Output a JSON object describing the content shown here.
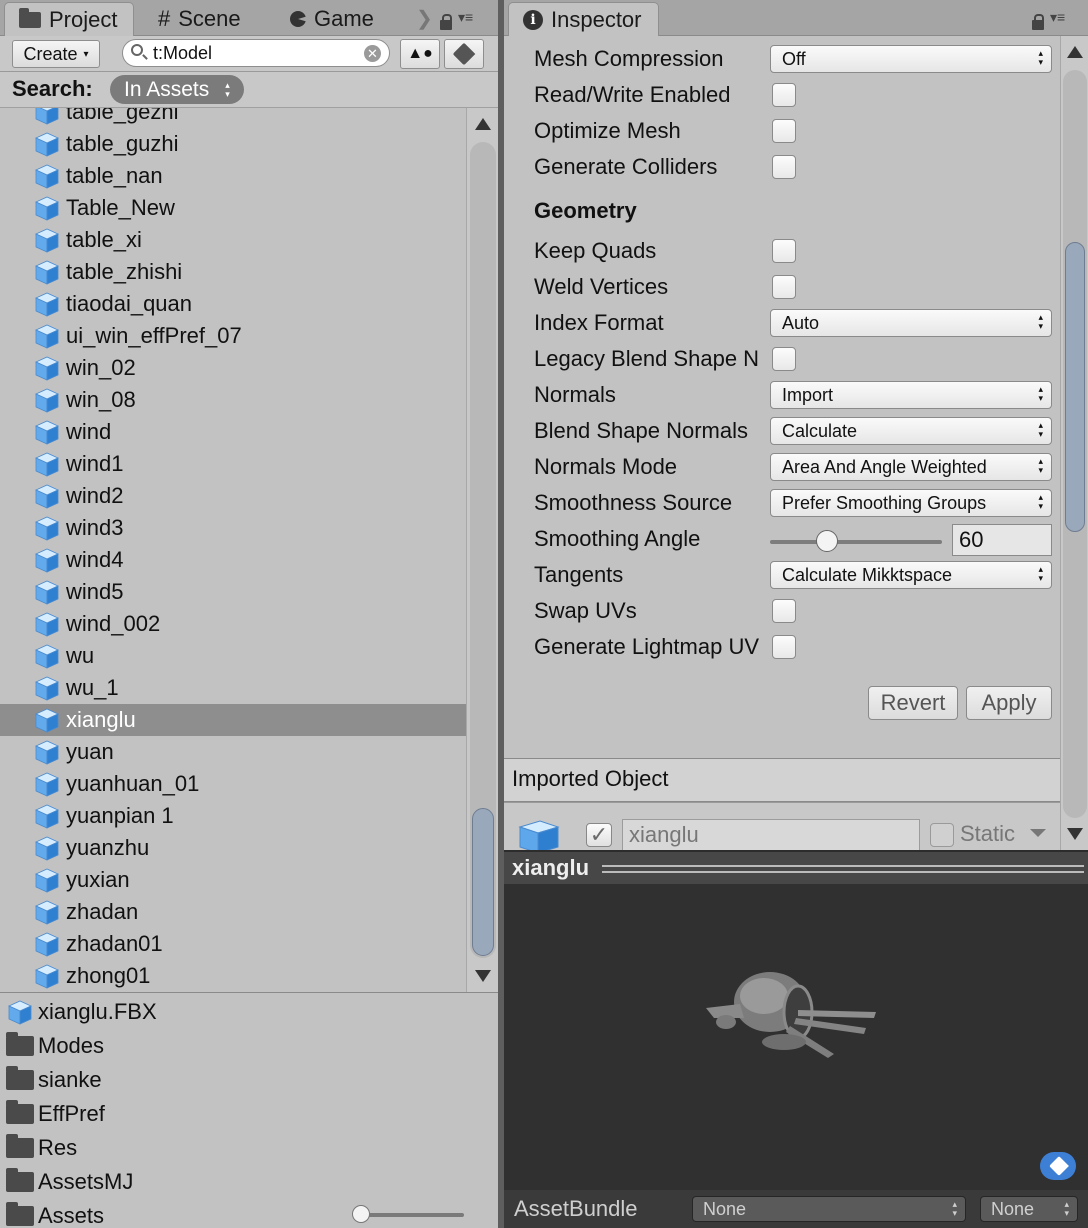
{
  "left_tabs": [
    {
      "label": "Project",
      "icon": "folder-icon"
    },
    {
      "label": "Scene",
      "icon": "grid-icon"
    },
    {
      "label": "Game",
      "icon": "pacman-icon"
    }
  ],
  "project_toolbar": {
    "create_label": "Create",
    "search_value": "t:Model"
  },
  "search_scope": {
    "label": "Search:",
    "value": "In Assets"
  },
  "assets": [
    {
      "name": "table_gezhi"
    },
    {
      "name": "table_guzhi"
    },
    {
      "name": "table_nan"
    },
    {
      "name": "Table_New"
    },
    {
      "name": "table_xi"
    },
    {
      "name": "table_zhishi"
    },
    {
      "name": "tiaodai_quan"
    },
    {
      "name": "ui_win_effPref_07"
    },
    {
      "name": "win_02"
    },
    {
      "name": "win_08"
    },
    {
      "name": "wind"
    },
    {
      "name": "wind1"
    },
    {
      "name": "wind2"
    },
    {
      "name": "wind3"
    },
    {
      "name": "wind4"
    },
    {
      "name": "wind5"
    },
    {
      "name": "wind_002"
    },
    {
      "name": "wu"
    },
    {
      "name": "wu_1"
    },
    {
      "name": "xianglu",
      "selected": true
    },
    {
      "name": "yuan"
    },
    {
      "name": "yuanhuan_01"
    },
    {
      "name": "yuanpian 1"
    },
    {
      "name": "yuanzhu"
    },
    {
      "name": "yuxian"
    },
    {
      "name": "zhadan"
    },
    {
      "name": "zhadan01"
    },
    {
      "name": "zhong01"
    }
  ],
  "folder_tree": [
    {
      "name": "xianglu.FBX",
      "icon": "model-icon"
    },
    {
      "name": "Modes",
      "icon": "folder-icon"
    },
    {
      "name": "sianke",
      "icon": "folder-icon"
    },
    {
      "name": "EffPref",
      "icon": "folder-icon"
    },
    {
      "name": "Res",
      "icon": "folder-icon"
    },
    {
      "name": "AssetsMJ",
      "icon": "folder-icon"
    },
    {
      "name": "Assets",
      "icon": "folder-icon"
    }
  ],
  "inspector": {
    "tab_label": "Inspector",
    "mesh_compression": {
      "label": "Mesh Compression",
      "value": "Off"
    },
    "read_write": {
      "label": "Read/Write Enabled",
      "checked": false
    },
    "optimize_mesh": {
      "label": "Optimize Mesh",
      "checked": false
    },
    "generate_colliders": {
      "label": "Generate Colliders",
      "checked": false
    },
    "geometry_header": "Geometry",
    "keep_quads": {
      "label": "Keep Quads",
      "checked": false
    },
    "weld_vertices": {
      "label": "Weld Vertices",
      "checked": false
    },
    "index_format": {
      "label": "Index Format",
      "value": "Auto"
    },
    "legacy_blend": {
      "label": "Legacy Blend Shape N",
      "checked": false
    },
    "normals": {
      "label": "Normals",
      "value": "Import"
    },
    "blend_shape_normals": {
      "label": "Blend Shape Normals",
      "value": "Calculate"
    },
    "normals_mode": {
      "label": "Normals Mode",
      "value": "Area And Angle Weighted"
    },
    "smoothness_source": {
      "label": "Smoothness Source",
      "value": "Prefer Smoothing Groups"
    },
    "smoothing_angle": {
      "label": "Smoothing Angle",
      "value": "60",
      "min": 0,
      "max": 180
    },
    "tangents": {
      "label": "Tangents",
      "value": "Calculate Mikktspace"
    },
    "swap_uvs": {
      "label": "Swap UVs",
      "checked": false
    },
    "generate_lightmap": {
      "label": "Generate Lightmap UV",
      "checked": false
    },
    "revert_label": "Revert",
    "apply_label": "Apply"
  },
  "imported_object": {
    "header": "Imported Object",
    "name": "xianglu",
    "active": true,
    "static_label": "Static"
  },
  "preview": {
    "title": "xianglu"
  },
  "asset_bundle": {
    "label": "AssetBundle",
    "name_value": "None",
    "variant_value": "None"
  },
  "colors": {
    "selection": "#8e8e8e",
    "scroll_thumb": "#9aa8bc",
    "preview_bg": "#303030",
    "tag_blue": "#3d7fd4"
  }
}
